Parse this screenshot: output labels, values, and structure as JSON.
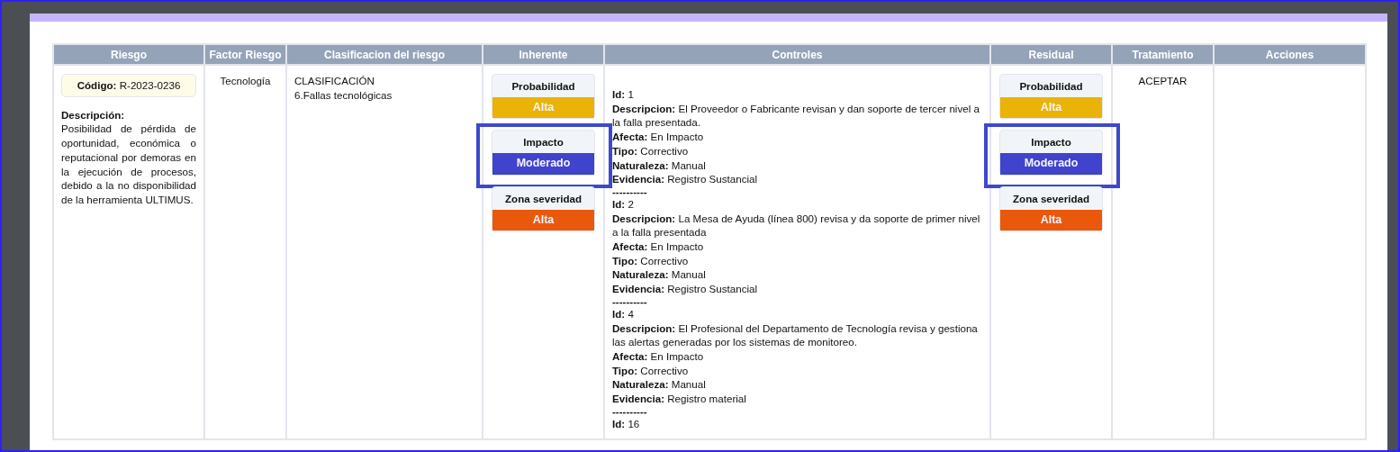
{
  "table": {
    "columns": [
      "Riesgo",
      "Factor Riesgo",
      "Clasificacion del riesgo",
      "Inherente",
      "Controles",
      "Residual",
      "Tratamiento",
      "Acciones"
    ],
    "rows": [
      {
        "riesgo": {
          "codigo_label": "Código:",
          "codigo": "R-2023-0236",
          "descripcion_label": "Descripción:",
          "descripcion": "Posibilidad de pérdida de oportunidad, económica o reputacional por demoras en la ejecución de procesos, debido a la no disponibilidad de la herramienta ULTIMUS."
        },
        "factor": "Tecnología",
        "clasificacion": [
          "CLASIFICACIÓN",
          "6.Fallas tecnológicas"
        ],
        "inherente": [
          {
            "label": "Probabilidad",
            "value": "Alta",
            "color": "#e9b308",
            "highlighted": false
          },
          {
            "label": "Impacto",
            "value": "Moderado",
            "color": "#4043cc",
            "highlighted": true
          },
          {
            "label": "Zona severidad",
            "value": "Alta",
            "color": "#ea580c",
            "highlighted": false
          }
        ],
        "controles": [
          {
            "fields": [
              {
                "label": "Id:",
                "value": "1"
              },
              {
                "label": "Descripcion:",
                "value": "El Proveedor o Fabricante revisan y dan soporte de tercer nivel a la falla presentada."
              },
              {
                "label": "Afecta:",
                "value": "En Impacto"
              },
              {
                "label": "Tipo:",
                "value": "Correctivo"
              },
              {
                "label": "Naturaleza:",
                "value": "Manual"
              },
              {
                "label": "Evidencia:",
                "value": "Registro Sustancial"
              }
            ],
            "separator": "----------"
          },
          {
            "fields": [
              {
                "label": "Id:",
                "value": "2"
              },
              {
                "label": "Descripcion:",
                "value": "La Mesa de Ayuda (línea 800) revisa y da soporte de primer nivel a la falla presentada"
              },
              {
                "label": "Afecta:",
                "value": "En Impacto"
              },
              {
                "label": "Tipo:",
                "value": "Correctivo"
              },
              {
                "label": "Naturaleza:",
                "value": "Manual"
              },
              {
                "label": "Evidencia:",
                "value": "Registro Sustancial"
              }
            ],
            "separator": "----------"
          },
          {
            "fields": [
              {
                "label": "Id:",
                "value": "4"
              },
              {
                "label": "Descripcion:",
                "value": "El Profesional del Departamento de Tecnología revisa y gestiona las alertas generadas por los sistemas de monitoreo."
              },
              {
                "label": "Afecta:",
                "value": "En Impacto"
              },
              {
                "label": "Tipo:",
                "value": "Correctivo"
              },
              {
                "label": "Naturaleza:",
                "value": "Manual"
              },
              {
                "label": "Evidencia:",
                "value": "Registro material"
              }
            ],
            "separator": "----------"
          },
          {
            "fields": [
              {
                "label": "Id:",
                "value": "16"
              }
            ]
          }
        ],
        "residual": [
          {
            "label": "Probabilidad",
            "value": "Alta",
            "color": "#e9b308",
            "highlighted": false
          },
          {
            "label": "Impacto",
            "value": "Moderado",
            "color": "#4043cc",
            "highlighted": true
          },
          {
            "label": "Zona severidad",
            "value": "Alta",
            "color": "#ea580c",
            "highlighted": false
          }
        ],
        "tratamiento": "ACEPTAR"
      }
    ]
  }
}
